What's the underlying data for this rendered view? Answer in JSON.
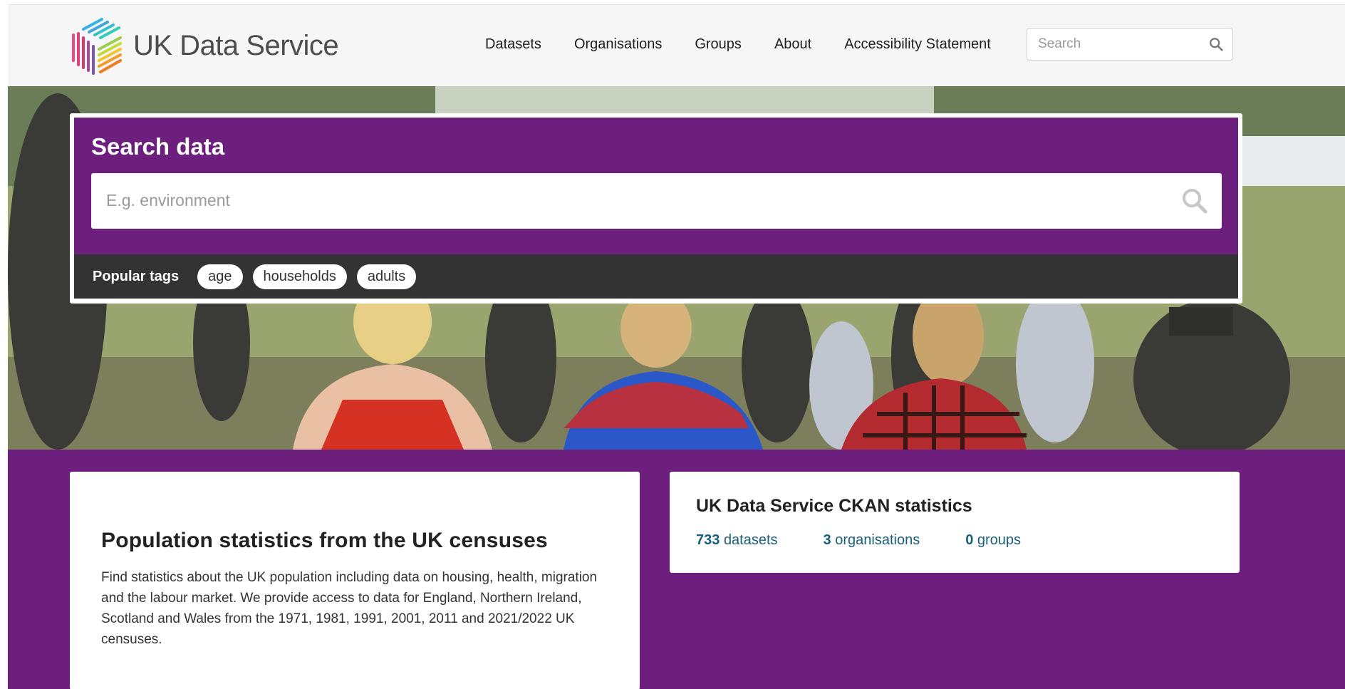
{
  "header": {
    "logo_text": "UK Data Service",
    "nav": [
      {
        "label": "Datasets"
      },
      {
        "label": "Organisations"
      },
      {
        "label": "Groups"
      },
      {
        "label": "About"
      },
      {
        "label": "Accessibility Statement"
      }
    ],
    "search": {
      "placeholder": "Search",
      "icon": "search-icon"
    }
  },
  "hero": {
    "title": "Search data",
    "search": {
      "placeholder": "E.g. environment",
      "icon": "search-icon"
    },
    "popular_tags_label": "Popular tags",
    "tags": [
      "age",
      "households",
      "adults"
    ]
  },
  "census_card": {
    "title": "Population statistics from the UK censuses",
    "body": "Find statistics about the UK population including data on housing, health, migration and the labour market. We provide access to data for England, Northern Ireland, Scotland and Wales from the 1971, 1981, 1991, 2001, 2011 and 2021/2022 UK censuses."
  },
  "stats_card": {
    "title": "UK Data Service CKAN statistics",
    "stats": [
      {
        "count": "733",
        "label": "datasets"
      },
      {
        "count": "3",
        "label": "organisations"
      },
      {
        "count": "0",
        "label": "groups"
      }
    ]
  },
  "colors": {
    "brand_purple": "#6d1f7e",
    "tag_bar": "#333333",
    "stat_link": "#1a5f7a"
  }
}
